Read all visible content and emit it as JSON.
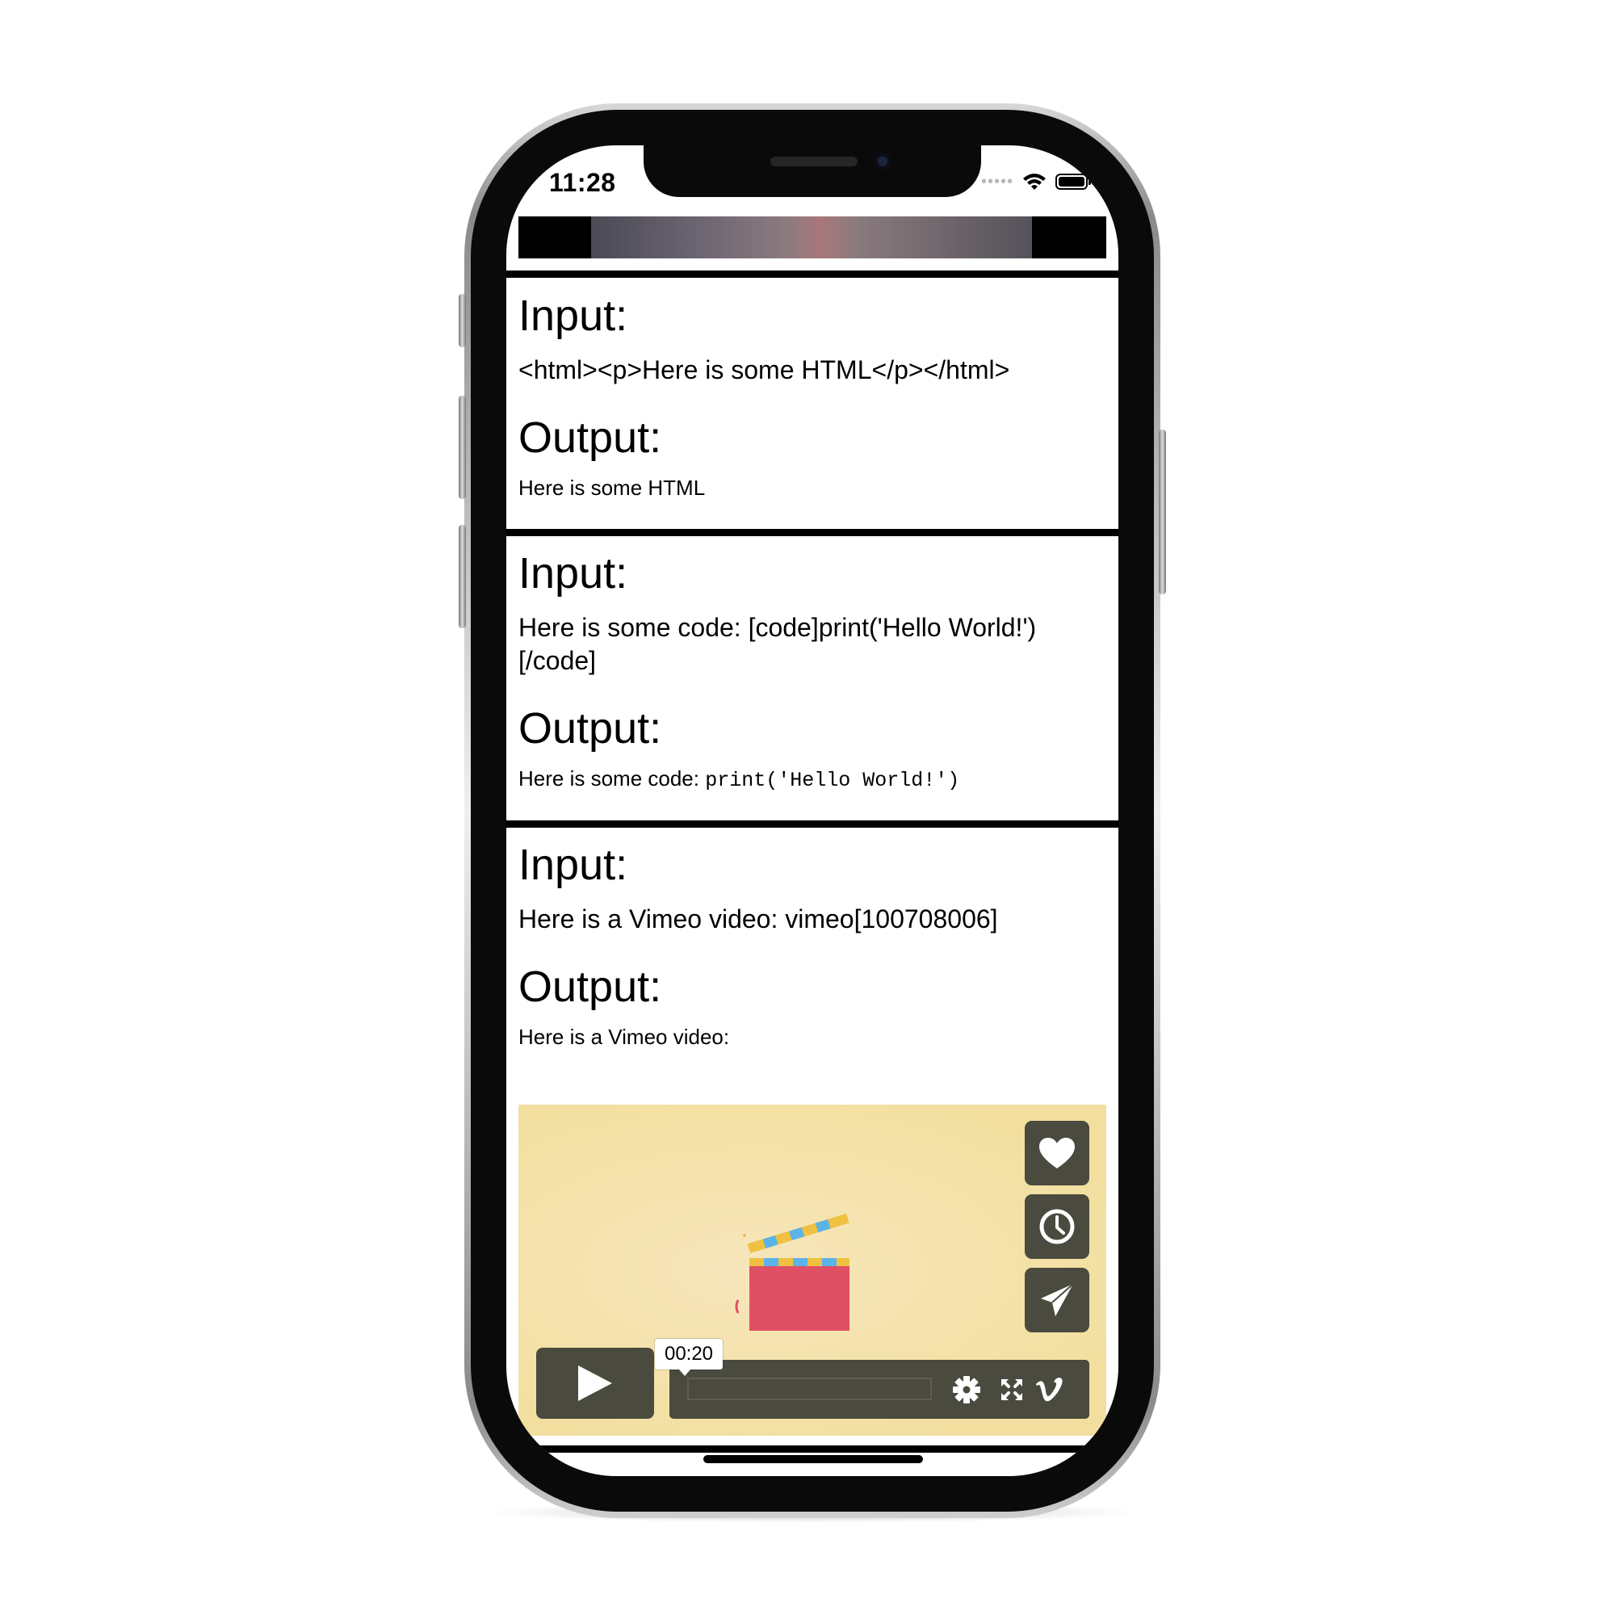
{
  "status_bar": {
    "time": "11:28",
    "signal_icon": "signal-dots-icon",
    "wifi_icon": "wifi-icon",
    "battery_icon": "battery-icon"
  },
  "sections": [
    {
      "input_heading": "Input:",
      "input_text": "<html><p>Here is some HTML</p></html>",
      "output_heading": "Output:",
      "output_text": "Here is some HTML"
    },
    {
      "input_heading": "Input:",
      "input_text": "Here is some code: [code]print('Hello World!')\n[/code]",
      "output_heading": "Output:",
      "output_text": "Here is some code: ",
      "output_code": "print('Hello World!')"
    },
    {
      "input_heading": "Input:",
      "input_text": "Here is a Vimeo video: vimeo[100708006]",
      "output_heading": "Output:",
      "output_text": "Here is a Vimeo video:"
    }
  ],
  "vimeo_player": {
    "time_tooltip": "00:20",
    "progress": 0,
    "icons": [
      "heart-icon",
      "clock-icon",
      "send-icon",
      "play-icon",
      "settings-icon",
      "fullscreen-icon",
      "vimeo-logo-icon"
    ],
    "colors": {
      "background": "#f2df9f",
      "controls": "#4a4a3e",
      "clapper_red": "#e05065",
      "clapper_yellow": "#f0c040",
      "clapper_blue": "#5ab4e8"
    }
  }
}
